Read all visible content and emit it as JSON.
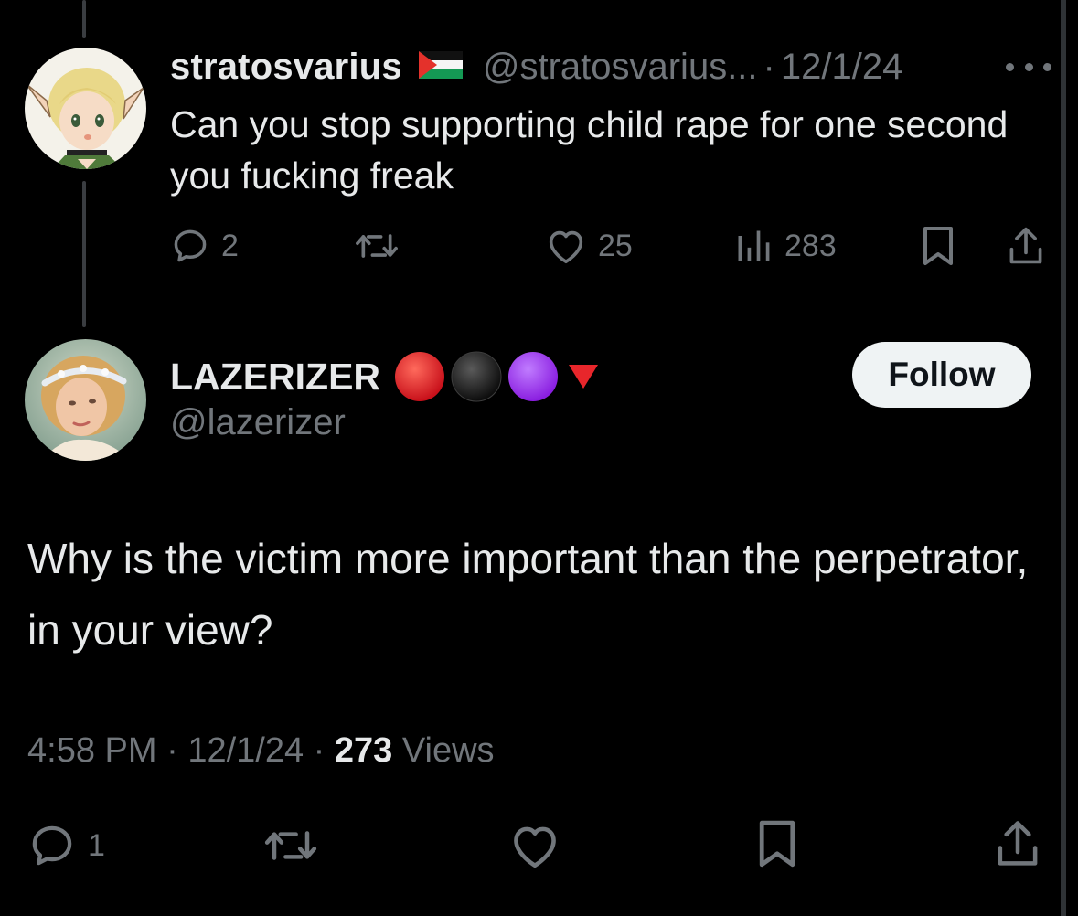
{
  "parent_tweet": {
    "display_name": "stratosvarius",
    "flag_icon": "palestine-flag-icon",
    "handle": "@stratosvarius...",
    "separator": "·",
    "date": "12/1/24",
    "text": "Can you stop supporting child rape for one second you fucking freak",
    "actions": {
      "reply_count": "2",
      "repost_count": "",
      "like_count": "25",
      "view_count": "283"
    }
  },
  "reply_tweet": {
    "display_name": "LAZERIZER",
    "emoji_icons": [
      "red-circle-icon",
      "black-circle-icon",
      "purple-circle-icon",
      "red-down-triangle-icon"
    ],
    "handle": "@lazerizer",
    "follow_label": "Follow",
    "text": "Why is the victim more important than the perpetrator, in your view?",
    "meta": {
      "time": "4:58 PM",
      "separator": "·",
      "date": "12/1/24",
      "views_count": "273",
      "views_label": "Views"
    },
    "actions": {
      "reply_count": "1"
    }
  },
  "colors": {
    "background": "#000000",
    "primary_text": "#e7e9ea",
    "secondary_text": "#71767b",
    "follow_button_bg": "#eff3f4",
    "thread_line": "#3a3d41"
  }
}
